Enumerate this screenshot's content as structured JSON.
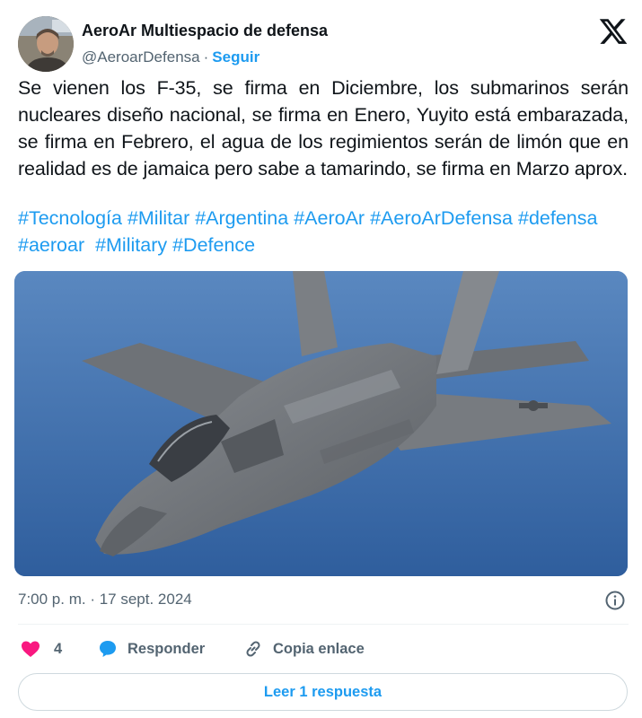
{
  "author": {
    "name": "AeroAr Multiespacio de defensa",
    "handle": "@AeroarDefensa",
    "separator": "·",
    "follow_label": "Seguir"
  },
  "brand_icon": "x-logo-icon",
  "tweet": {
    "text": "Se vienen los F-35, se firma en Diciembre, los submarinos serán nucleares diseño nacional, se firma en Enero, Yuyito está embarazada, se firma en Febrero, el agua de los regimientos serán de limón que en realidad es de jamaica pero sabe a tamarindo, se firma en Marzo aprox.",
    "hashtags": [
      "#Tecnología",
      "#Militar",
      "#Argentina",
      "#AeroAr",
      "#AeroArDefensa",
      "#defensa",
      "#aeroar",
      "#Military",
      "#Defence"
    ]
  },
  "media": {
    "description_icon": "f35-jet-photo",
    "sky_color": "#3c6eac"
  },
  "meta": {
    "timestamp": "7:00 p. m. · 17 sept. 2024"
  },
  "actions": {
    "like_count": "4",
    "reply_label": "Responder",
    "copy_label": "Copia enlace"
  },
  "read_replies_label": "Leer 1 respuesta",
  "colors": {
    "accent": "#1d9bf0",
    "like": "#f91880",
    "text": "#0f1419",
    "muted": "#536471"
  }
}
